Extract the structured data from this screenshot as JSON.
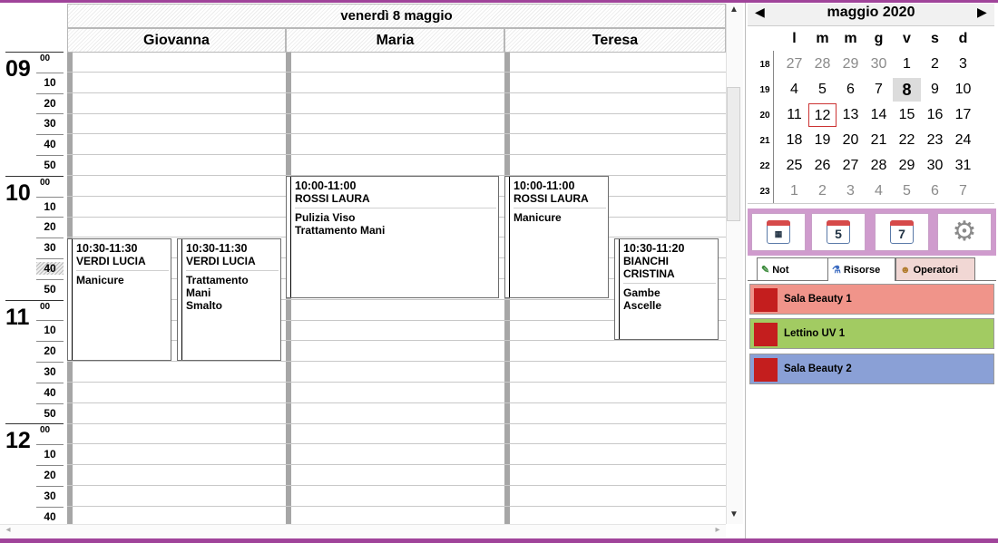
{
  "day_header": "venerdì 8 maggio",
  "operators": [
    "Giovanna",
    "Maria",
    "Teresa"
  ],
  "hours": [
    "09",
    "10",
    "11",
    "12"
  ],
  "minutes": [
    "00",
    "10",
    "20",
    "30",
    "40",
    "50"
  ],
  "highlight_minute": "40",
  "appointments": [
    {
      "time": "10:30-11:30",
      "customer": "VERDI LUCIA",
      "services": "Manicure"
    },
    {
      "time": "10:30-11:30",
      "customer": "VERDI LUCIA",
      "services": "Trattamento\nMani\nSmalto"
    },
    {
      "time": "10:00-11:00",
      "customer": "ROSSI LAURA",
      "services": "Pulizia Viso\nTrattamento Mani"
    },
    {
      "time": "10:00-11:00",
      "customer": "ROSSI LAURA",
      "services": "Manicure"
    },
    {
      "time": "10:30-11:20",
      "customer": "BIANCHI\nCRISTINA",
      "services": "Gambe\nAscelle"
    }
  ],
  "calendar": {
    "month_label": "maggio 2020",
    "prev": "◀",
    "next": "▶",
    "weekdays": [
      "l",
      "m",
      "m",
      "g",
      "v",
      "s",
      "d"
    ],
    "weeks": [
      {
        "num": "18",
        "days": [
          [
            "27",
            1
          ],
          [
            "28",
            1
          ],
          [
            "29",
            1
          ],
          [
            "30",
            1
          ],
          [
            "1",
            0
          ],
          [
            "2",
            0
          ],
          [
            "3",
            0
          ]
        ]
      },
      {
        "num": "19",
        "days": [
          [
            "4",
            0
          ],
          [
            "5",
            0
          ],
          [
            "6",
            0
          ],
          [
            "7",
            0
          ],
          [
            "8",
            0
          ],
          [
            "9",
            0
          ],
          [
            "10",
            0
          ]
        ]
      },
      {
        "num": "20",
        "days": [
          [
            "11",
            0
          ],
          [
            "12",
            0
          ],
          [
            "13",
            0
          ],
          [
            "14",
            0
          ],
          [
            "15",
            0
          ],
          [
            "16",
            0
          ],
          [
            "17",
            0
          ]
        ]
      },
      {
        "num": "21",
        "days": [
          [
            "18",
            0
          ],
          [
            "19",
            0
          ],
          [
            "20",
            0
          ],
          [
            "21",
            0
          ],
          [
            "22",
            0
          ],
          [
            "23",
            0
          ],
          [
            "24",
            0
          ]
        ]
      },
      {
        "num": "22",
        "days": [
          [
            "25",
            0
          ],
          [
            "26",
            0
          ],
          [
            "27",
            0
          ],
          [
            "28",
            0
          ],
          [
            "29",
            0
          ],
          [
            "30",
            0
          ],
          [
            "31",
            0
          ]
        ]
      },
      {
        "num": "23",
        "days": [
          [
            "1",
            1
          ],
          [
            "2",
            1
          ],
          [
            "3",
            1
          ],
          [
            "4",
            1
          ],
          [
            "5",
            1
          ],
          [
            "6",
            1
          ],
          [
            "7",
            1
          ]
        ]
      }
    ],
    "selected": "8",
    "today": "12"
  },
  "toolbar": {
    "day_icon": "calendar-day-icon",
    "five_label": "5",
    "seven_label": "7",
    "settings_icon": "gear-icon"
  },
  "tabs": [
    {
      "label": "Not",
      "icon": "note-icon"
    },
    {
      "label": "Risorse",
      "icon": "resources-icon"
    },
    {
      "label": "Operatori",
      "icon": "operators-icon"
    }
  ],
  "resources": [
    {
      "name": "Sala Beauty 1",
      "color": "#f0948a"
    },
    {
      "name": "Lettino UV 1",
      "color": "#a2cb62"
    },
    {
      "name": "Sala Beauty 2",
      "color": "#8aa0d6"
    }
  ]
}
